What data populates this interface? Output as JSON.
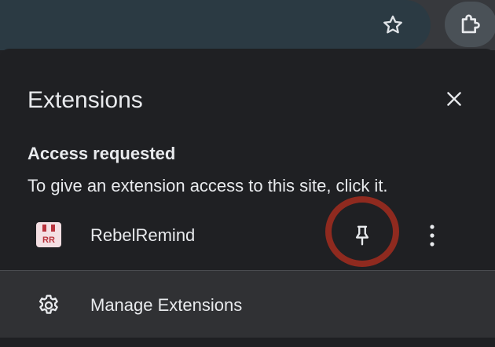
{
  "toolbar": {
    "bookmark_icon": "star-outline-icon",
    "extensions_icon": "puzzle-piece-icon"
  },
  "menu": {
    "title": "Extensions",
    "close_icon": "close-icon",
    "section": {
      "heading": "Access requested",
      "description": "To give an extension access to this site, click it."
    },
    "extensions": [
      {
        "name": "RebelRemind",
        "icon": "rebelremind-logo-icon",
        "icon_text": "RR",
        "pin_icon": "pin-icon",
        "more_icon": "more-vert-icon"
      }
    ],
    "manage": {
      "label": "Manage Extensions",
      "icon": "gear-icon"
    }
  },
  "colors": {
    "toolbar_bg": "#37393d",
    "omnibox_bg": "#2b3a43",
    "menu_bg": "#1f2023",
    "footer_bg": "#303134",
    "text": "#e8eaed",
    "highlight_ring": "#8f2a1f",
    "extension_logo_bg": "#f4dfe3",
    "extension_logo_fg": "#b8323c"
  }
}
